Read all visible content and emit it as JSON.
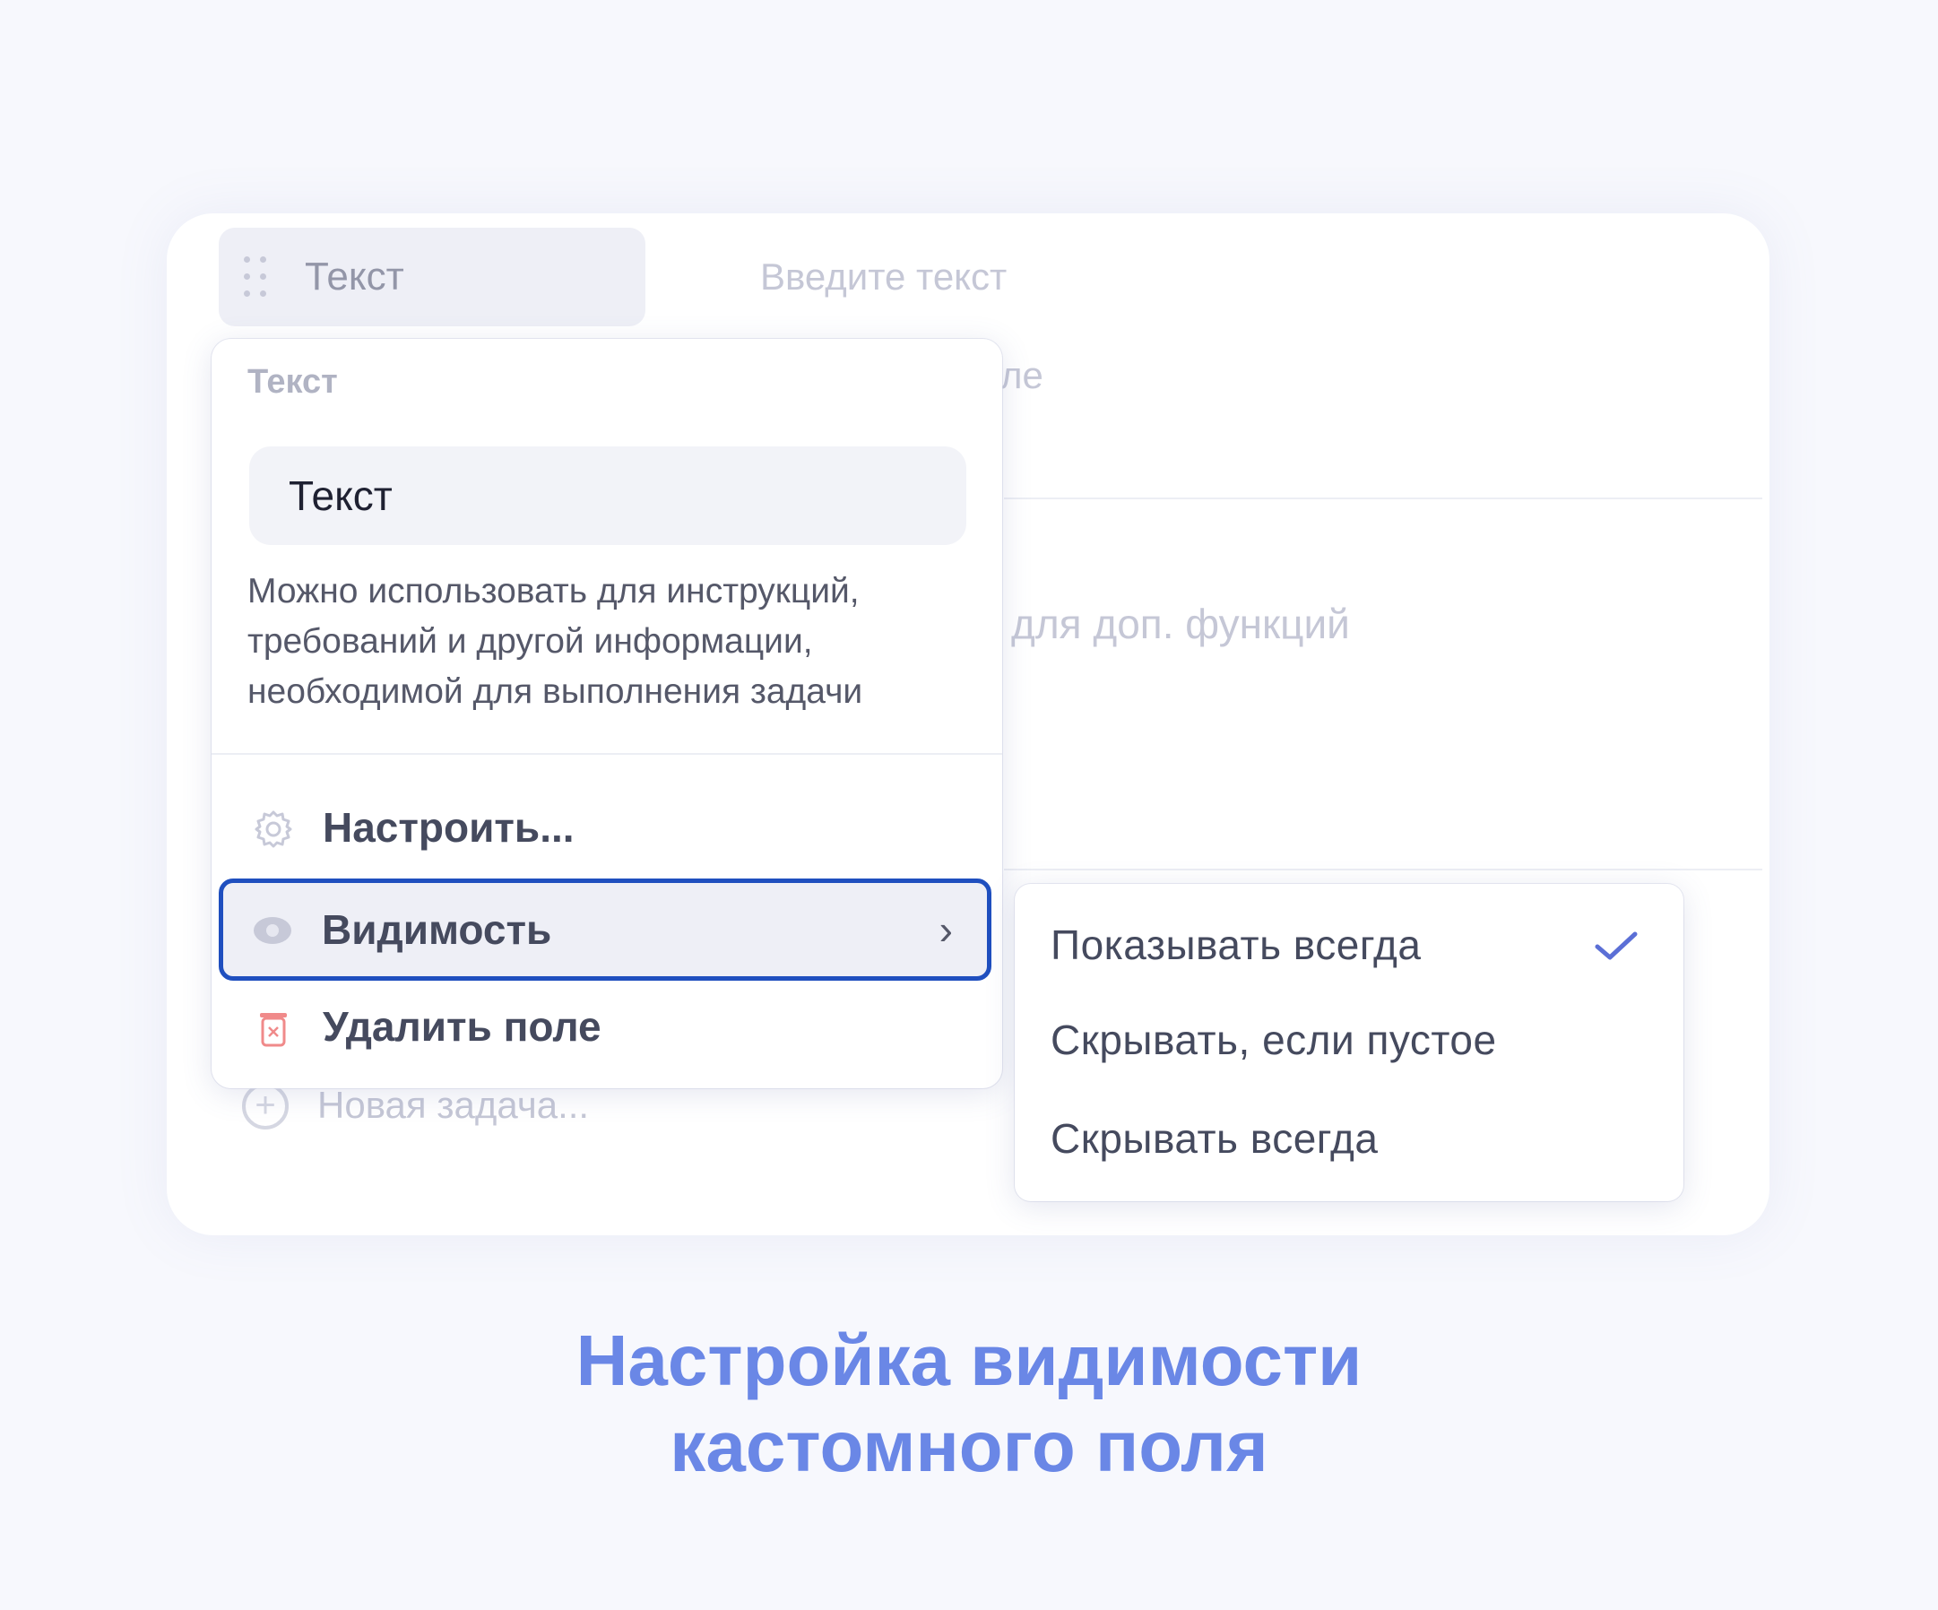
{
  "background_field": {
    "chip_label": "Текст",
    "placeholder": "Введите текст",
    "partial_text_1": "ле",
    "partial_text_2": "для доп. функций",
    "new_task_label": "Новая задача..."
  },
  "menu": {
    "heading": "Текст",
    "name_value": "Текст",
    "description": "Можно использовать для инструкций, требований и другой информации, необходимой для выполнения задачи",
    "items": [
      {
        "label": "Настроить...",
        "icon": "gear-icon"
      },
      {
        "label": "Видимость",
        "icon": "eye-icon",
        "selected": true
      },
      {
        "label": "Удалить поле",
        "icon": "trash-icon"
      }
    ]
  },
  "submenu": {
    "options": [
      {
        "label": "Показывать всегда",
        "checked": true
      },
      {
        "label": "Скрывать, если пустое",
        "checked": false
      },
      {
        "label": "Скрывать всегда",
        "checked": false
      }
    ]
  },
  "caption": {
    "line1": "Настройка видимости",
    "line2": "кастомного поля"
  },
  "colors": {
    "accent_blue": "#1f4fbf",
    "caption_blue": "#6a87e6",
    "check_blue": "#5b6fd6",
    "delete_red": "#f08a8a"
  }
}
